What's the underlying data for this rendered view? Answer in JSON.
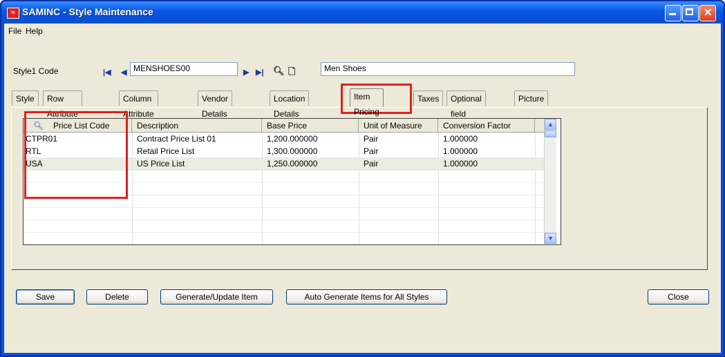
{
  "window": {
    "title": "SAMINC - Style Maintenance"
  },
  "menu": [
    {
      "label": "File"
    },
    {
      "label": "Help"
    }
  ],
  "style1": {
    "label": "Style1 Code",
    "code": "MENSHOES00",
    "description": "Men Shoes"
  },
  "tabs": [
    {
      "label": "Style"
    },
    {
      "label": "Row Attribute"
    },
    {
      "label": "Column Attribute"
    },
    {
      "label": "Vendor Details"
    },
    {
      "label": "Location Details"
    },
    {
      "label": "Item Pricing"
    },
    {
      "label": "Taxes"
    },
    {
      "label": "Optional field"
    },
    {
      "label": "Picture"
    }
  ],
  "active_tab": "Item Pricing",
  "grid": {
    "headers": [
      "Price List Code",
      "Description",
      "Base Price",
      "Unit of Measure",
      "Conversion Factor"
    ],
    "rows": [
      {
        "code": "CTPR01",
        "description": "Contract Price List 01",
        "base_price": "1,200.000000",
        "uom": "Pair",
        "factor": "1.000000"
      },
      {
        "code": "RTL",
        "description": "Retail Price List",
        "base_price": "1,300.000000",
        "uom": "Pair",
        "factor": "1.000000"
      },
      {
        "code": "USA",
        "description": "US Price List",
        "base_price": "1,250.000000",
        "uom": "Pair",
        "factor": "1.000000"
      }
    ]
  },
  "buttons": {
    "save": "Save",
    "delete": "Delete",
    "generate": "Generate/Update Item",
    "auto_generate": "Auto Generate Items for All Styles",
    "close": "Close"
  },
  "colors": {
    "highlight_box": "#e02020",
    "titlebar": "#0a5ae6",
    "window_bg": "#ece9d8"
  }
}
